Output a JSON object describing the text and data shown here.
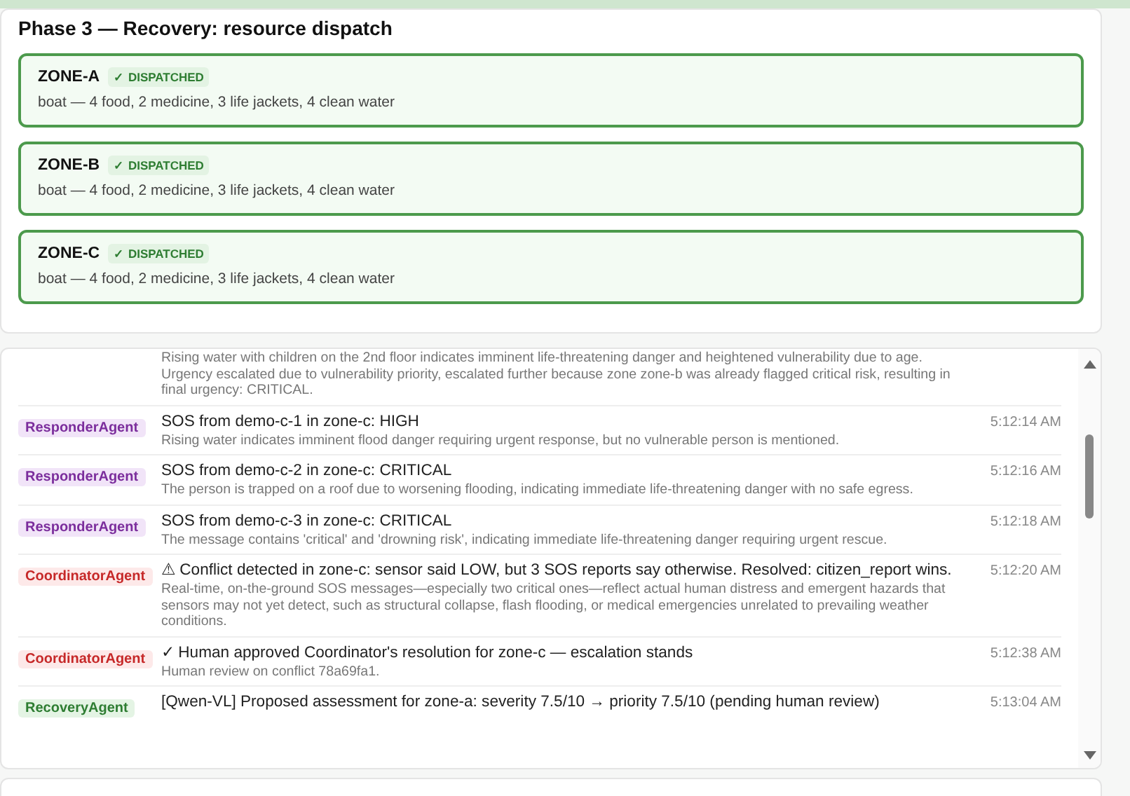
{
  "dispatch": {
    "title": "Phase 3 — Recovery: resource dispatch",
    "zones": [
      {
        "name": "ZONE-A",
        "status": "✓ DISPATCHED",
        "resources": "boat — 4 food, 2 medicine, 3 life jackets, 4 clean water"
      },
      {
        "name": "ZONE-B",
        "status": "✓ DISPATCHED",
        "resources": "boat — 4 food, 2 medicine, 3 life jackets, 4 clean water"
      },
      {
        "name": "ZONE-C",
        "status": "✓ DISPATCHED",
        "resources": "boat — 4 food, 2 medicine, 3 life jackets, 4 clean water"
      }
    ]
  },
  "log": {
    "entries": [
      {
        "detail": "Rising water with children on the 2nd floor indicates imminent life-threatening danger and heightened vulnerability due to age. Urgency escalated due to vulnerability priority, escalated further because zone zone-b was already flagged critical risk, resulting in final urgency: CRITICAL."
      },
      {
        "kind": "responder",
        "agent": "ResponderAgent",
        "title": "SOS from demo-c-1 in zone-c: HIGH",
        "detail": "Rising water indicates imminent flood danger requiring urgent response, but no vulnerable person is mentioned.",
        "time": "5:12:14 AM"
      },
      {
        "kind": "responder",
        "agent": "ResponderAgent",
        "title": "SOS from demo-c-2 in zone-c: CRITICAL",
        "detail": "The person is trapped on a roof due to worsening flooding, indicating immediate life-threatening danger with no safe egress.",
        "time": "5:12:16 AM"
      },
      {
        "kind": "responder",
        "agent": "ResponderAgent",
        "title": "SOS from demo-c-3 in zone-c: CRITICAL",
        "detail": "The message contains 'critical' and 'drowning risk', indicating immediate life-threatening danger requiring urgent rescue.",
        "time": "5:12:18 AM"
      },
      {
        "kind": "coordinator",
        "agent": "CoordinatorAgent",
        "title": "⚠ Conflict detected in zone-c: sensor said LOW, but 3 SOS reports say otherwise. Resolved: citizen_report wins.",
        "detail": "Real-time, on-the-ground SOS messages—especially two critical ones—reflect actual human distress and emergent hazards that sensors may not yet detect, such as structural collapse, flash flooding, or medical emergencies unrelated to prevailing weather conditions.",
        "time": "5:12:20 AM"
      },
      {
        "kind": "coordinator",
        "agent": "CoordinatorAgent",
        "title": "✓ Human approved Coordinator's resolution for zone-c — escalation stands",
        "detail": "Human review on conflict 78a69fa1.",
        "time": "5:12:38 AM"
      },
      {
        "kind": "recovery",
        "agent": "RecoveryAgent",
        "title": "[Qwen-VL] Proposed assessment for zone-a: severity 7.5/10 → priority 7.5/10 (pending human review)",
        "time": "5:13:04 AM"
      }
    ]
  }
}
